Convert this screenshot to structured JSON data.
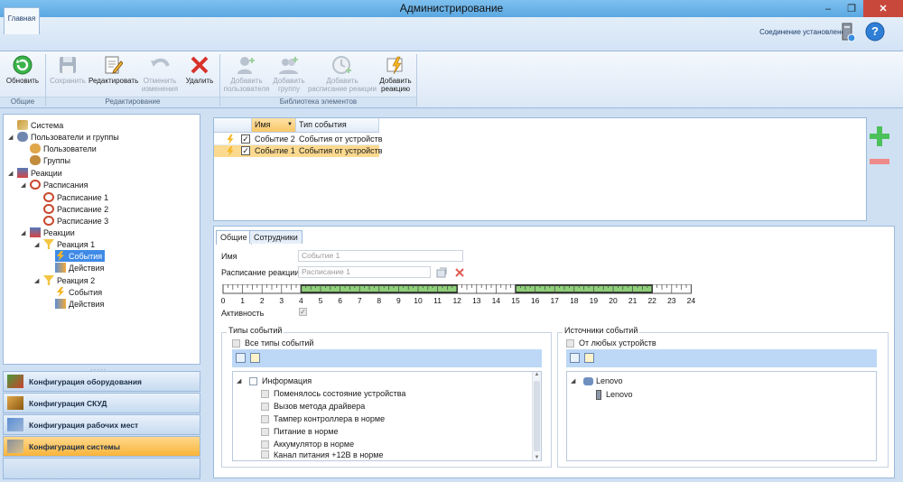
{
  "window": {
    "title": "Администрирование"
  },
  "tabs": {
    "main": "Главная"
  },
  "status": {
    "connection": "Соединение установлено"
  },
  "ribbon": {
    "refresh": "Обновить",
    "save": "Сохранить",
    "edit": "Редактировать",
    "cancel_line1": "Отменить",
    "cancel_line2": "изменения",
    "delete": "Удалить",
    "add_user_line1": "Добавить",
    "add_user_line2": "пользователя",
    "add_group_line1": "Добавить",
    "add_group_line2": "группу",
    "add_schedule_line1": "Добавить",
    "add_schedule_line2": "расписание реакции",
    "add_reaction_line1": "Добавить",
    "add_reaction_line2": "реакцию",
    "group_general": "Общие",
    "group_edit": "Редактирование",
    "group_library": "Библиотека элементов"
  },
  "tree": [
    {
      "label": "Система"
    },
    {
      "label": "Пользователи и группы"
    },
    {
      "label": "Пользователи"
    },
    {
      "label": "Группы"
    },
    {
      "label": "Реакции"
    },
    {
      "label": "Расписания"
    },
    {
      "label": "Расписание 1"
    },
    {
      "label": "Расписание 2"
    },
    {
      "label": "Расписание 3"
    },
    {
      "label": "Реакции"
    },
    {
      "label": "Реакция 1"
    },
    {
      "label": "События"
    },
    {
      "label": "Действия"
    },
    {
      "label": "Реакция 2"
    },
    {
      "label": "События"
    },
    {
      "label": "Действия"
    }
  ],
  "nav": [
    {
      "label": "Конфигурация оборудования"
    },
    {
      "label": "Конфигурация СКУД"
    },
    {
      "label": "Конфигурация рабочих мест"
    },
    {
      "label": "Конфигурация системы"
    }
  ],
  "grid": {
    "columns": [
      "Имя",
      "Тип события"
    ],
    "rows": [
      {
        "name": "Событие 2",
        "type": "События от устройств"
      },
      {
        "name": "Событие 1",
        "type": "События от устройств"
      }
    ]
  },
  "detail": {
    "tabs": [
      "Общие",
      "Сотрудники"
    ],
    "name_label": "Имя",
    "name_value": "Событие 1",
    "schedule_label": "Расписание реакции",
    "schedule_value": "Расписание 1",
    "active_label": "Активность",
    "timeline_hours": [
      "0",
      "1",
      "2",
      "3",
      "4",
      "5",
      "6",
      "7",
      "8",
      "9",
      "10",
      "11",
      "12",
      "13",
      "14",
      "15",
      "16",
      "17",
      "18",
      "19",
      "20",
      "21",
      "22",
      "23",
      "24"
    ],
    "active_ranges": [
      [
        4,
        12
      ],
      [
        15,
        22
      ]
    ]
  },
  "event_types": {
    "title": "Типы событий",
    "all_label": "Все типы событий",
    "group": "Информация",
    "items": [
      "Поменялось состояние устройства",
      "Вызов метода драйвера",
      "Тампер контроллера в норме",
      "Питание в норме",
      "Аккумулятор в норме",
      "Канал питания +12В в норме"
    ]
  },
  "sources": {
    "title": "Источники событий",
    "any_label": "От любых устройств",
    "root": "Lenovo",
    "child": "Lenovo"
  },
  "colors": {
    "accent": "#f9b43a",
    "ribbon": "#dce8f6",
    "selection": "#fbd98f"
  }
}
